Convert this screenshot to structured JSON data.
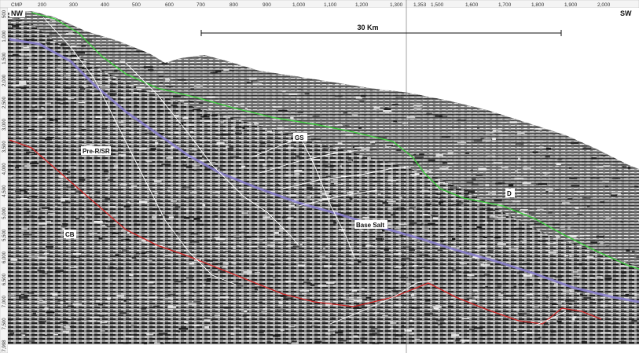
{
  "header": {
    "cmp_label": "CMP",
    "cmp_ticks": [
      "200",
      "300",
      "400",
      "500",
      "600",
      "700",
      "800",
      "900",
      "1,000",
      "1,100",
      "1,200",
      "1,300",
      "1,353",
      "1,500",
      "1,600",
      "1,700",
      "1,800",
      "1,900",
      "2,000"
    ],
    "time_ticks": [
      "500",
      "1,000",
      "1,500",
      "2,000",
      "2,500",
      "3,000",
      "3,500",
      "4,000",
      "4,500",
      "5,000",
      "5,500",
      "6,000",
      "6,500",
      "7,000",
      "7,500",
      "7,998"
    ]
  },
  "orientation": {
    "left": "NW",
    "right": "SW"
  },
  "scale_bar": {
    "label": "30 Km"
  },
  "labels": {
    "gs": "GS",
    "pre_rsr": "Pre-R/SR",
    "d": "D",
    "base_salt": "Base Salt",
    "cb": "CB"
  },
  "colors": {
    "horizon_green": "#3fd23f",
    "horizon_purple": "#8a7fd0",
    "horizon_red": "#d42a2a",
    "fault_white": "#ffffff",
    "seismic_dark": "#2a2a2a",
    "seismic_light": "#d9d9d9"
  }
}
